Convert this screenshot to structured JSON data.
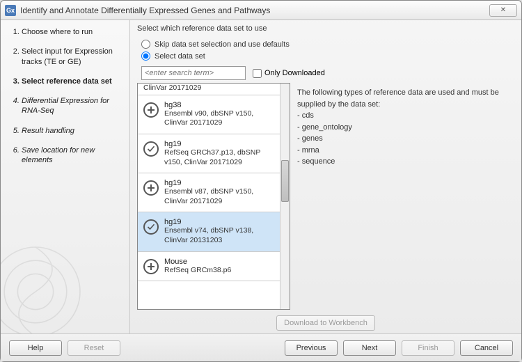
{
  "window": {
    "app_icon_text": "Gx",
    "title": "Identify and Annotate Differentially Expressed Genes and Pathways",
    "close_glyph": "✕"
  },
  "steps": [
    {
      "label": "Choose where to run",
      "style": ""
    },
    {
      "label": "Select input for Expression tracks (TE or GE)",
      "style": ""
    },
    {
      "label": "Select reference data set",
      "style": "bold"
    },
    {
      "label": "Differential Expression for RNA-Seq",
      "style": "italic"
    },
    {
      "label": "Result handling",
      "style": "italic"
    },
    {
      "label": "Save location for new elements",
      "style": "italic"
    }
  ],
  "main": {
    "heading": "Select which reference data set to use",
    "radios": {
      "skip": {
        "label": "Skip data set selection and use defaults",
        "checked": false
      },
      "select": {
        "label": "Select data set",
        "checked": true
      }
    },
    "search_placeholder": "<enter search term>",
    "only_downloaded_label": "Only Downloaded",
    "only_downloaded_checked": false,
    "download_button": "Download to Workbench"
  },
  "datasets": [
    {
      "name": "",
      "desc": "ClinVar 20171029",
      "marker": "plus",
      "selected": false,
      "partial": true
    },
    {
      "name": "hg38",
      "desc": "Ensembl v90, dbSNP v150, ClinVar 20171029",
      "marker": "plus",
      "selected": false
    },
    {
      "name": "hg19",
      "desc": "RefSeq GRCh37.p13, dbSNP v150, ClinVar 20171029",
      "marker": "check",
      "selected": false
    },
    {
      "name": "hg19",
      "desc": "Ensembl v87, dbSNP v150, ClinVar 20171029",
      "marker": "plus",
      "selected": false
    },
    {
      "name": "hg19",
      "desc": "Ensembl v74, dbSNP v138, ClinVar 20131203",
      "marker": "check",
      "selected": true
    },
    {
      "name": "Mouse",
      "desc": "RefSeq GRCm38.p6",
      "marker": "plus",
      "selected": false
    }
  ],
  "info": {
    "heading": "The following types of reference data are used and must be supplied by the data set:",
    "items": [
      "cds",
      "gene_ontology",
      "genes",
      "mrna",
      "sequence"
    ]
  },
  "footer": {
    "help": "Help",
    "reset": "Reset",
    "previous": "Previous",
    "next": "Next",
    "finish": "Finish",
    "cancel": "Cancel"
  }
}
